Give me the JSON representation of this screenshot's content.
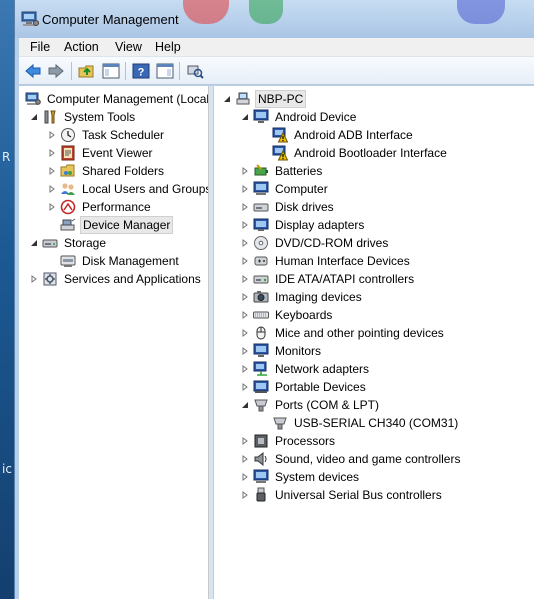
{
  "window": {
    "title": "Computer Management"
  },
  "desktop": {
    "letters": [
      "R",
      "ic"
    ]
  },
  "menu": [
    {
      "label": "File"
    },
    {
      "label": "Action"
    },
    {
      "label": "View"
    },
    {
      "label": "Help"
    }
  ],
  "left_tree": {
    "root": "Computer Management (Local",
    "system_tools": "System Tools",
    "task_scheduler": "Task Scheduler",
    "event_viewer": "Event Viewer",
    "shared_folders": "Shared Folders",
    "local_users": "Local Users and Groups",
    "performance": "Performance",
    "device_manager": "Device Manager",
    "storage": "Storage",
    "disk_management": "Disk Management",
    "services": "Services and Applications"
  },
  "right_tree": {
    "root": "NBP-PC",
    "android_device": "Android Device",
    "adb": "Android ADB Interface",
    "bootloader": "Android Bootloader Interface",
    "batteries": "Batteries",
    "computer": "Computer",
    "disk_drives": "Disk drives",
    "display_adapters": "Display adapters",
    "dvd": "DVD/CD-ROM drives",
    "hid": "Human Interface Devices",
    "ide": "IDE ATA/ATAPI controllers",
    "imaging": "Imaging devices",
    "keyboards": "Keyboards",
    "mice": "Mice and other pointing devices",
    "monitors": "Monitors",
    "network": "Network adapters",
    "portable": "Portable Devices",
    "ports": "Ports (COM & LPT)",
    "usb_serial": "USB-SERIAL CH340 (COM31)",
    "processors": "Processors",
    "sound": "Sound, video and game controllers",
    "system_devices": "System devices",
    "usb_controllers": "Universal Serial Bus controllers"
  },
  "colors": {
    "title_bar": "#aac6e6",
    "warning": "#f2c200",
    "selection": "#e8e8e8"
  }
}
